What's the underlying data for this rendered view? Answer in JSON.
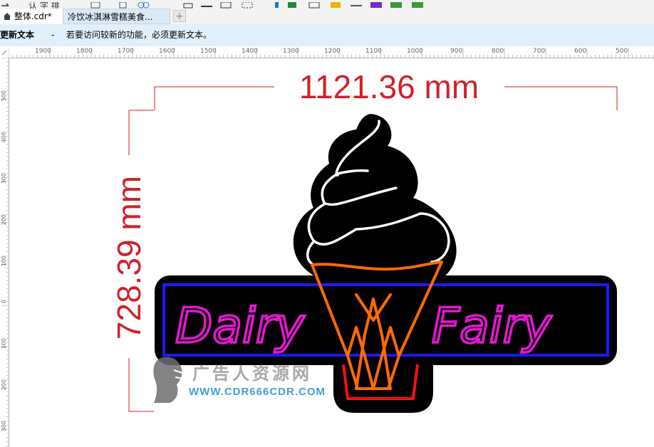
{
  "tabs": {
    "doc1": "整体.cdr*",
    "doc2": "冷饮冰淇淋雪糕美食...",
    "add": "+"
  },
  "infobar": {
    "title": "更新文本",
    "separator": "-",
    "message": "若要访问较新的功能，必须更新文本。"
  },
  "ruler_h": [
    "1900",
    "1800",
    "1700",
    "1600",
    "1500",
    "1400",
    "1300",
    "1200",
    "1100",
    "1000",
    "900",
    "800",
    "700",
    "600",
    "500"
  ],
  "ruler_v": [
    "500",
    "400",
    "300",
    "200",
    "100",
    "0",
    "100",
    "200",
    "300"
  ],
  "dimensions": {
    "width": "1121.36 mm",
    "height": "728.39 mm"
  },
  "sign": {
    "left_word": "Dairy",
    "right_word": "Fairy"
  },
  "watermark": {
    "text": "广告人资源网",
    "url": "WWW.CDR666CDR.COM"
  },
  "colors": {
    "dimension_red": "#d0202a",
    "neon_pink": "#e815d6",
    "neon_blue": "#1a1aff",
    "neon_orange": "#ff6a00",
    "neon_red": "#ff1010"
  }
}
